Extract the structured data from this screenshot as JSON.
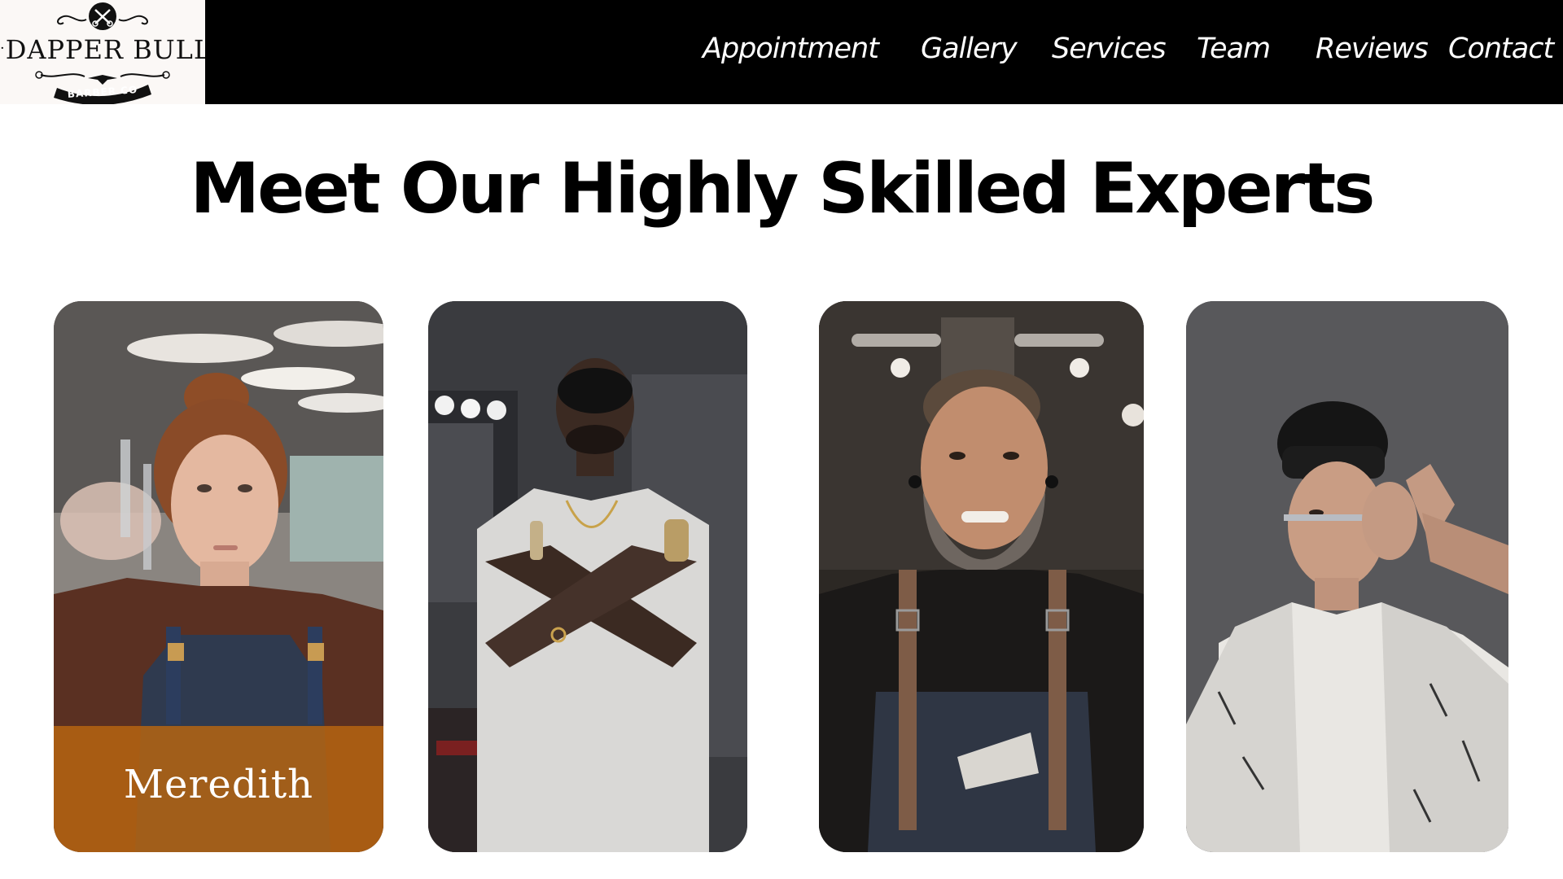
{
  "brand": {
    "name": "DAPPER BULLY",
    "tagline": "BARBER CO",
    "icon": "scissors-emblem-icon"
  },
  "nav": {
    "items": [
      {
        "label": "Appointment"
      },
      {
        "label": "Gallery"
      },
      {
        "label": "Services"
      },
      {
        "label": "Team"
      },
      {
        "label": "Reviews"
      },
      {
        "label": "Contact"
      }
    ]
  },
  "team": {
    "heading": "Meet Our Highly Skilled Experts",
    "members": [
      {
        "name": "Meredith",
        "photo": "barber-woman-holding-scissors"
      },
      {
        "name": "",
        "photo": "barber-man-crossed-clippers"
      },
      {
        "name": "",
        "photo": "barber-man-smiling-apron"
      },
      {
        "name": "",
        "photo": "barber-man-beanie-scissors"
      }
    ]
  },
  "colors": {
    "header_bg": "#000000",
    "accent": "#b56412",
    "text_light": "#ffffff"
  }
}
